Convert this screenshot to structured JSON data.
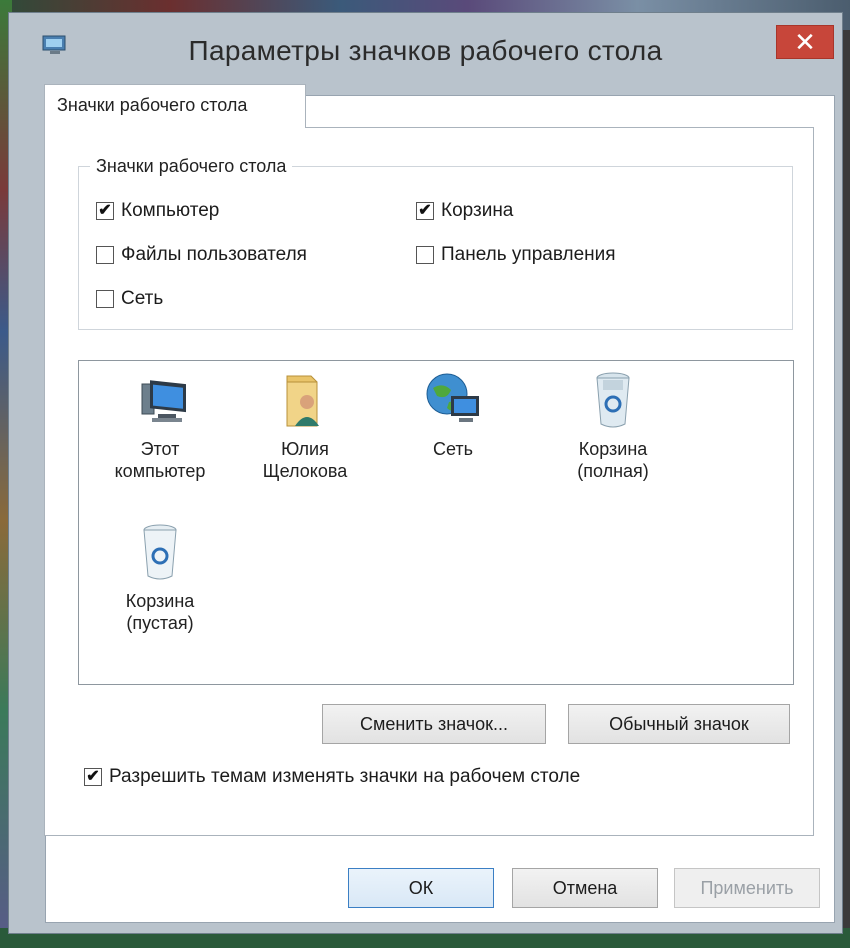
{
  "window": {
    "title": "Параметры значков рабочего стола",
    "close_glyph": "✕"
  },
  "tab": {
    "label": "Значки рабочего стола"
  },
  "group": {
    "legend": "Значки рабочего стола",
    "checkboxes": [
      {
        "label": "Компьютер",
        "checked": true
      },
      {
        "label": "Корзина",
        "checked": true
      },
      {
        "label": "Файлы пользователя",
        "checked": false
      },
      {
        "label": "Панель управления",
        "checked": false
      },
      {
        "label": "Сеть",
        "checked": false
      }
    ]
  },
  "icons": [
    {
      "label": "Этот компьютер",
      "icon": "computer-icon"
    },
    {
      "label": "Юлия Щелокова",
      "icon": "user-folder-icon"
    },
    {
      "label": "Сеть",
      "icon": "network-icon"
    },
    {
      "label": "Корзина (полная)",
      "icon": "recycle-bin-full-icon"
    },
    {
      "label": "Корзина (пустая)",
      "icon": "recycle-bin-empty-icon"
    }
  ],
  "buttons": {
    "change_icon": "Сменить значок...",
    "default_icon": "Обычный значок",
    "ok": "ОК",
    "cancel": "Отмена",
    "apply": "Применить"
  },
  "themes_checkbox": {
    "label": "Разрешить темам изменять значки на рабочем столе",
    "checked": true
  },
  "check_glyph": "✔",
  "colors": {
    "close": "#c7463a",
    "frame": "#b9c3cc"
  }
}
